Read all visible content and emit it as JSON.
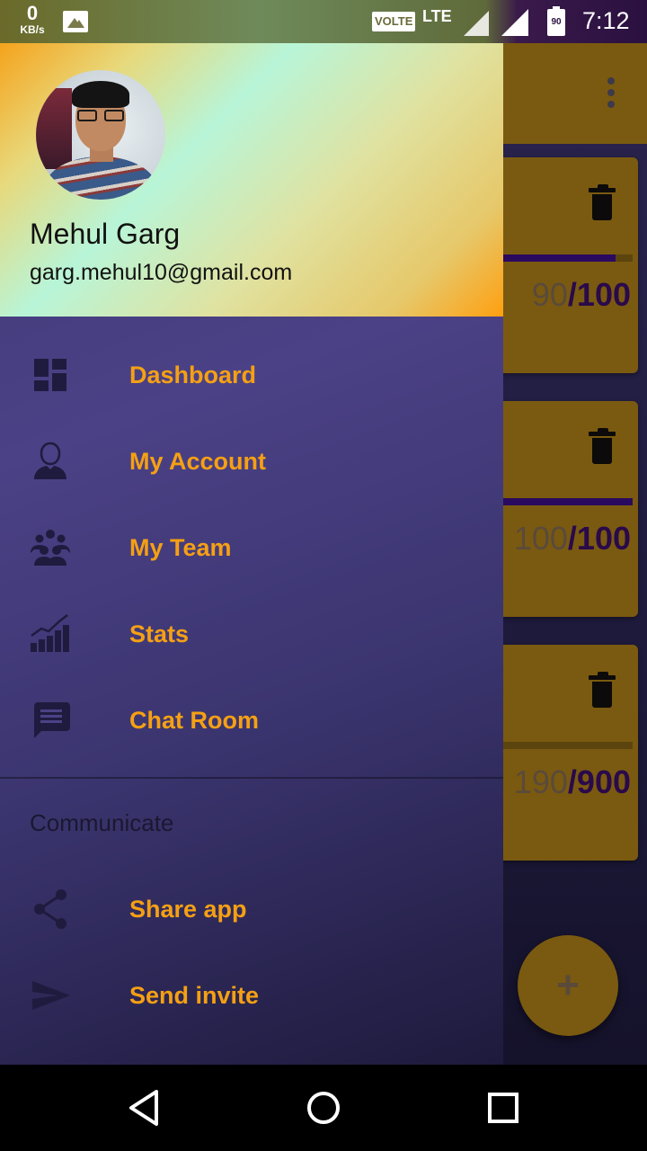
{
  "status_bar": {
    "speed_value": "0",
    "speed_unit": "KB/s",
    "volte": "VOLTE",
    "network": "LTE",
    "battery": "90",
    "time": "7:12"
  },
  "profile": {
    "name": "Mehul Garg",
    "email": "garg.mehul10@gmail.com"
  },
  "menu": {
    "items": [
      {
        "label": "Dashboard",
        "icon": "dashboard-icon"
      },
      {
        "label": "My Account",
        "icon": "account-icon"
      },
      {
        "label": "My Team",
        "icon": "team-icon"
      },
      {
        "label": "Stats",
        "icon": "stats-icon"
      },
      {
        "label": "Chat Room",
        "icon": "chat-icon"
      }
    ],
    "section_title": "Communicate",
    "section_items": [
      {
        "label": "Share app",
        "icon": "share-icon"
      },
      {
        "label": "Send invite",
        "icon": "send-icon"
      }
    ]
  },
  "cards": [
    {
      "done": "90",
      "total": "/100",
      "progress": 0.9
    },
    {
      "done": "100",
      "total": "/100",
      "progress": 1.0
    },
    {
      "done": "190",
      "total": "/900",
      "progress": 0.21
    }
  ],
  "fab": {
    "label": "+"
  },
  "colors": {
    "accent": "#f5a014",
    "drawer_bg": "#4b4186",
    "card_bg": "#7a5a10"
  }
}
